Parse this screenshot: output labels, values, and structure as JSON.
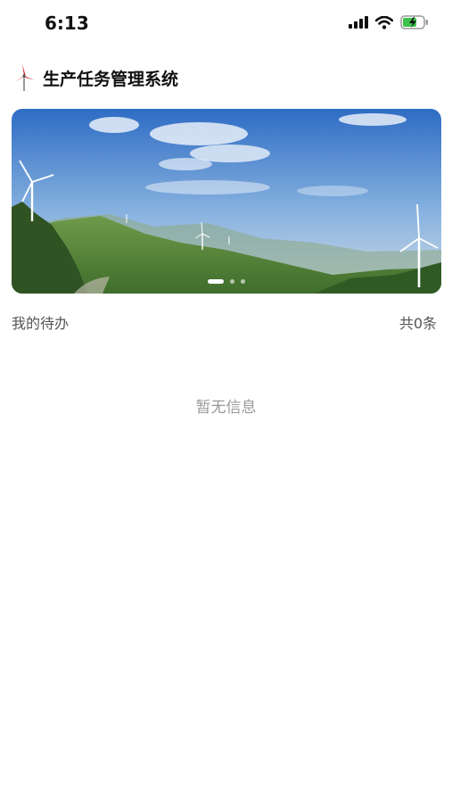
{
  "status_bar": {
    "time": "6:13",
    "icons": [
      "signal-icon",
      "wifi-icon",
      "battery-charging-icon"
    ],
    "battery_color": "#3cc24a"
  },
  "header": {
    "logo_icon": "wind-turbine-icon",
    "title": "生产任务管理系统",
    "logo_color": "#d8232a"
  },
  "banner": {
    "slides": 3,
    "active_slide": 1
  },
  "todo": {
    "label": "我的待办",
    "count_text": "共0条",
    "empty_text": "暂无信息"
  }
}
